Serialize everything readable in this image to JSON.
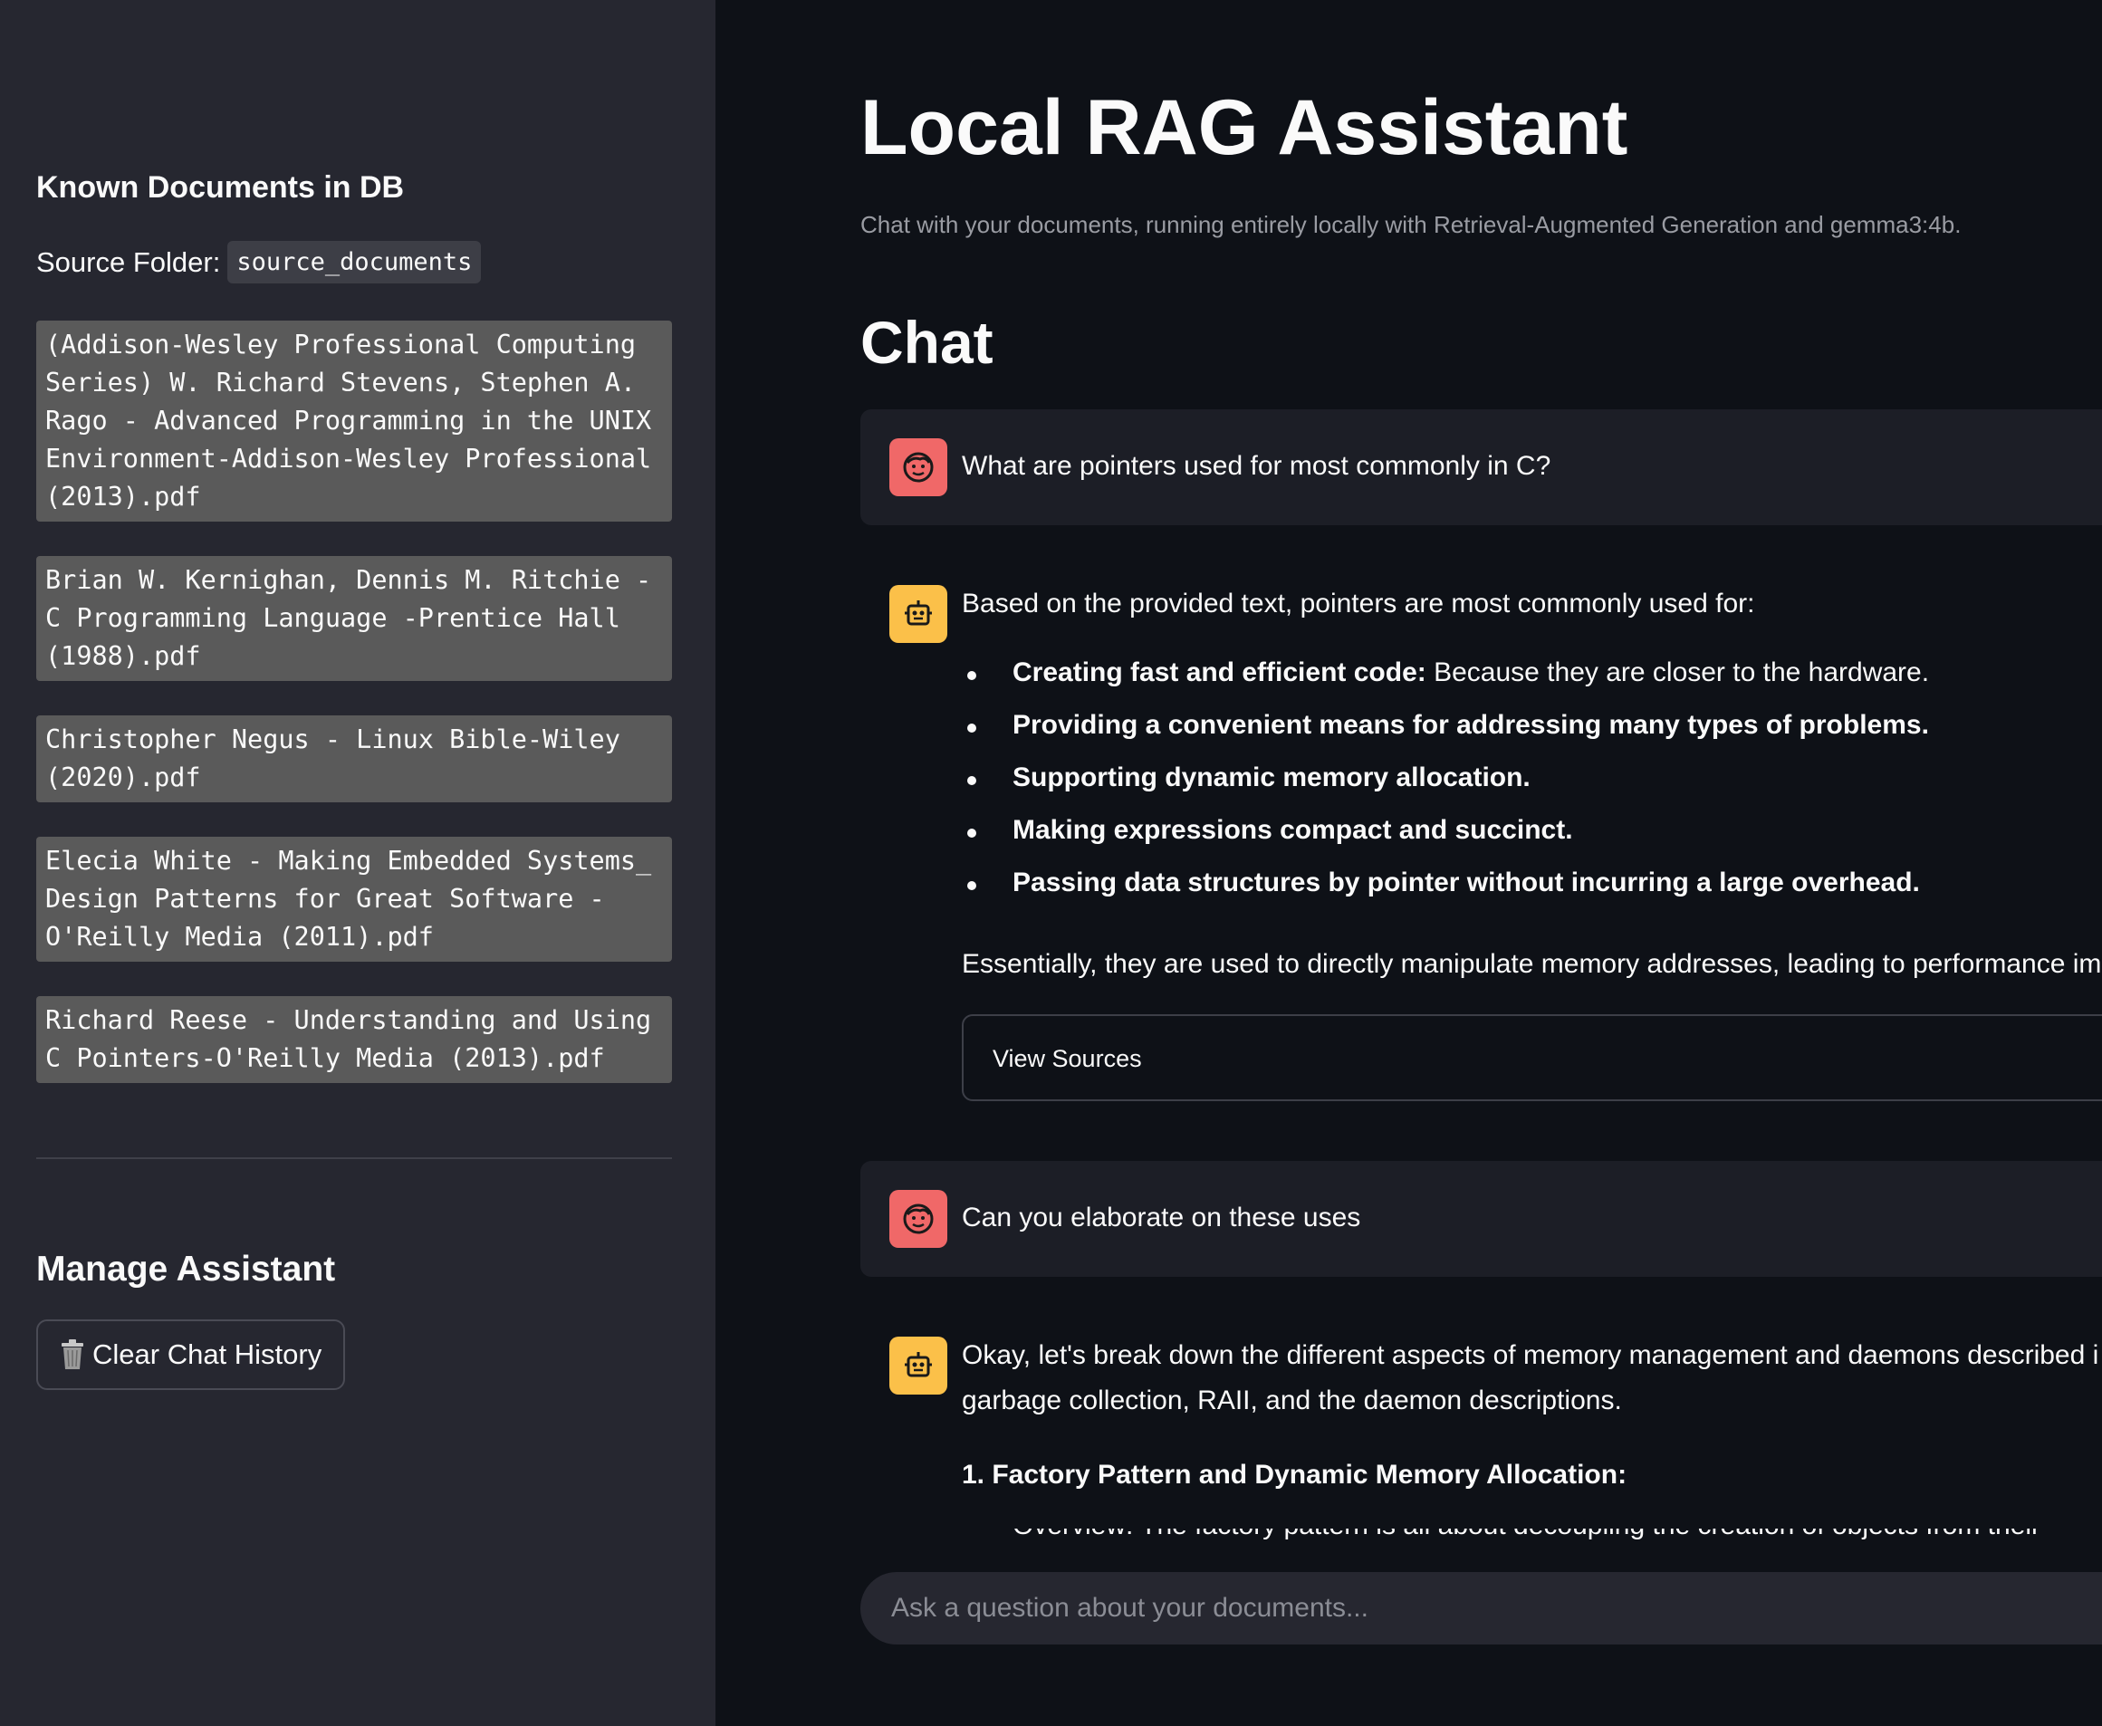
{
  "sidebar": {
    "heading": "Known Documents in DB",
    "source_label": "Source Folder:",
    "source_folder": "source_documents",
    "documents": [
      "(Addison-Wesley Professional Computing Series) W. Richard Stevens, Stephen A. Rago - Advanced Programming in the UNIX Environment-Addison-Wesley Professional (2013).pdf",
      "Brian W. Kernighan, Dennis M. Ritchie - C Programming Language -Prentice Hall (1988).pdf",
      "Christopher Negus - Linux Bible-Wiley (2020).pdf",
      "Elecia White - Making Embedded Systems_ Design Patterns for Great Software - O'Reilly Media (2011).pdf",
      "Richard Reese - Understanding and Using C Pointers-O'Reilly Media (2013).pdf"
    ],
    "manage_heading": "Manage Assistant",
    "clear_button": "Clear Chat History"
  },
  "main": {
    "title": "Local RAG Assistant",
    "caption": "Chat with your documents, running entirely locally with Retrieval-Augmented Generation and gemma3:4b.",
    "chat_heading": "Chat",
    "messages": {
      "user1": "What are pointers used for most commonly in C?",
      "bot1_intro": "Based on the provided text, pointers are most commonly used for:",
      "bot1_bullets": [
        {
          "bold": "Creating fast and efficient code:",
          "rest": " Because they are closer to the hardware."
        },
        {
          "bold": "Providing a convenient means for addressing many types of problems.",
          "rest": ""
        },
        {
          "bold": "Supporting dynamic memory allocation.",
          "rest": ""
        },
        {
          "bold": "Making expressions compact and succinct.",
          "rest": ""
        },
        {
          "bold": "Passing data structures by pointer without incurring a large overhead.",
          "rest": ""
        }
      ],
      "bot1_summary": "Essentially, they are used to directly manipulate memory addresses, leading to performance im",
      "view_sources": "View Sources",
      "user2": "Can you elaborate on these uses",
      "bot2_line1": "Okay, let's break down the different aspects of memory management and daemons described i",
      "bot2_line2": "garbage collection, RAII, and the daemon descriptions.",
      "bot2_heading": "1. Factory Pattern and Dynamic Memory Allocation:",
      "bot2_clipped": "Overview: The factory pattern is all about decoupling the creation of objects from their"
    },
    "input_placeholder": "Ask a question about your documents..."
  },
  "colors": {
    "sidebar_bg": "#262730",
    "main_bg": "#0e1117",
    "user_avatar": "#f06868",
    "bot_avatar": "#fbc049",
    "doc_chip": "#5a5a5a"
  }
}
